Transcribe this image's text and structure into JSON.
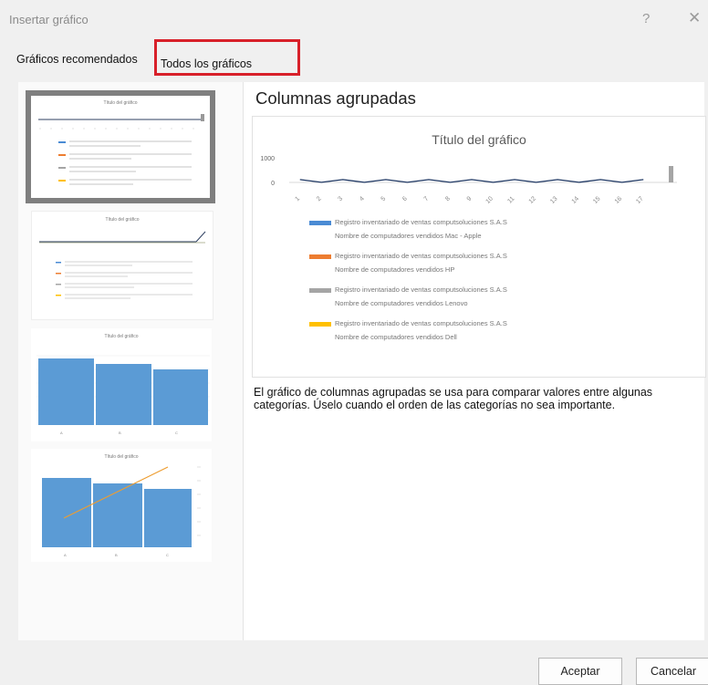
{
  "dialog": {
    "title": "Insertar gráfico",
    "help_glyph": "?",
    "close_glyph": "✕"
  },
  "tabs": [
    {
      "label": "Gráficos recomendados",
      "selected": false
    },
    {
      "label": "Todos los gráficos",
      "selected": false,
      "highlighted": true
    }
  ],
  "highlight_color": "#d8202a",
  "thumbnails": [
    {
      "title": "Título del gráfico",
      "kind": "line",
      "selected": true
    },
    {
      "title": "Título del gráfico",
      "kind": "line",
      "selected": false
    },
    {
      "title": "Título del gráfico",
      "kind": "bar",
      "selected": false
    },
    {
      "title": "Título del gráfico",
      "kind": "bar-line",
      "selected": false
    }
  ],
  "preview": {
    "heading": "Columnas agrupadas",
    "description": "El gráfico de columnas agrupadas se usa para comparar valores entre algunas categorías. Úselo cuando el orden de las categorías no sea importante."
  },
  "chart_data": {
    "type": "bar",
    "title": "Título del gráfico",
    "ylim": [
      0,
      1000
    ],
    "yticks": [
      "1000",
      "0"
    ],
    "categories": [
      "1",
      "2",
      "3",
      "4",
      "5",
      "6",
      "7",
      "8",
      "9",
      "10",
      "11",
      "12",
      "13",
      "14",
      "15",
      "16",
      "17"
    ],
    "series": [
      {
        "name": "Registro inventariado de ventas computsoluciones S.A.S Nombre de computadores vendidos Mac - Apple",
        "color": "#4a8bd4",
        "values": [
          60,
          60,
          60,
          60,
          60,
          60,
          60,
          60,
          60,
          60,
          60,
          60,
          60,
          60,
          60,
          60,
          60
        ]
      },
      {
        "name": "Registro inventariado de ventas computsoluciones S.A.S Nombre de computadores vendidos HP",
        "color": "#ed7d31",
        "values": [
          0,
          0,
          0,
          0,
          0,
          0,
          0,
          0,
          0,
          0,
          0,
          0,
          0,
          0,
          0,
          0,
          0
        ]
      },
      {
        "name": "Registro inventariado de ventas computsoluciones S.A.S Nombre de computadores vendidos Lenovo",
        "color": "#a5a5a5",
        "values": [
          0,
          0,
          0,
          0,
          0,
          0,
          0,
          0,
          0,
          0,
          0,
          0,
          0,
          0,
          0,
          0,
          0
        ]
      },
      {
        "name": "Registro inventariado de ventas computsoluciones S.A.S Nombre de computadores vendidos Dell",
        "color": "#ffc000",
        "values": [
          0,
          0,
          0,
          0,
          0,
          0,
          0,
          0,
          0,
          0,
          0,
          0,
          0,
          0,
          0,
          0,
          0
        ]
      }
    ],
    "line_color": "#1f3864",
    "grid": true,
    "legend_position": "bottom"
  },
  "buttons": {
    "ok": "Aceptar",
    "cancel": "Cancelar"
  }
}
